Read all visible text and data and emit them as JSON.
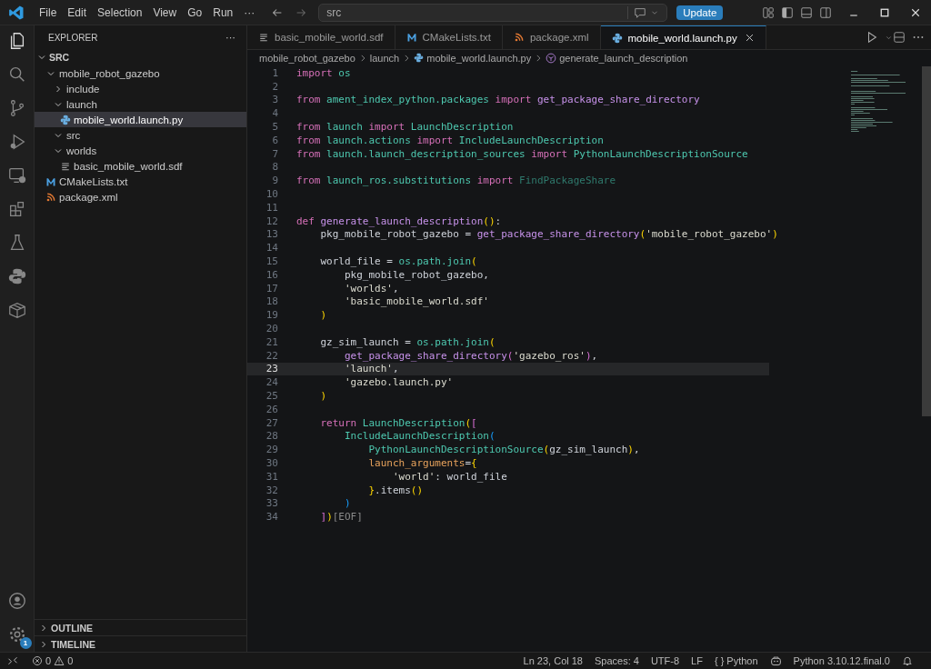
{
  "menu": [
    "File",
    "Edit",
    "Selection",
    "View",
    "Go",
    "Run",
    "···"
  ],
  "command_center": {
    "value": "src"
  },
  "update_button": "Update",
  "sidebar": {
    "title": "EXPLORER",
    "more": "···",
    "section": {
      "label": "SRC",
      "expanded": true,
      "children": [
        {
          "label": "mobile_robot_gazebo",
          "kind": "folder",
          "expanded": true,
          "selected": false,
          "children": [
            {
              "label": "include",
              "kind": "folder",
              "expanded": false,
              "selected": false
            },
            {
              "label": "launch",
              "kind": "folder",
              "expanded": true,
              "selected": false,
              "children": [
                {
                  "label": "mobile_world.launch.py",
                  "kind": "py",
                  "selected": true
                }
              ]
            },
            {
              "label": "src",
              "kind": "folder",
              "expanded": true,
              "selected": false
            },
            {
              "label": "worlds",
              "kind": "folder",
              "expanded": true,
              "selected": false,
              "children": [
                {
                  "label": "basic_mobile_world.sdf",
                  "kind": "sdf",
                  "selected": false
                }
              ]
            }
          ]
        },
        {
          "label": "CMakeLists.txt",
          "kind": "cmake",
          "selected": false
        },
        {
          "label": "package.xml",
          "kind": "xml",
          "selected": false
        }
      ]
    },
    "panels": [
      {
        "label": "OUTLINE",
        "expanded": false
      },
      {
        "label": "TIMELINE",
        "expanded": false
      }
    ]
  },
  "settings_badge": "1",
  "tabs": [
    {
      "label": "basic_mobile_world.sdf",
      "kind": "sdf",
      "selected": false
    },
    {
      "label": "CMakeLists.txt",
      "kind": "cmake",
      "selected": false
    },
    {
      "label": "package.xml",
      "kind": "xml",
      "selected": false
    },
    {
      "label": "mobile_world.launch.py",
      "kind": "py",
      "selected": true
    }
  ],
  "breadcrumbs": [
    {
      "label": "mobile_robot_gazebo",
      "kind": "folder"
    },
    {
      "label": "launch",
      "kind": "folder"
    },
    {
      "label": "mobile_world.launch.py",
      "kind": "py"
    },
    {
      "label": "generate_launch_description",
      "kind": "symbol"
    }
  ],
  "code": [
    {
      "n": "1",
      "current": false,
      "tokens": [
        {
          "t": "import",
          "kind": "kw"
        },
        {
          "t": " os",
          "kind": "mod"
        }
      ]
    },
    {
      "n": "2",
      "current": false
    },
    {
      "n": "3",
      "current": false,
      "tokens": [
        {
          "t": "from",
          "kind": "kw"
        },
        {
          "t": " ament_index_python.packages",
          "kind": "mod"
        },
        {
          "t": " import",
          "kind": "kw"
        },
        {
          "t": " get_package_share_directory",
          "kind": "fn"
        }
      ]
    },
    {
      "n": "4",
      "current": false
    },
    {
      "n": "5",
      "current": false,
      "tokens": [
        {
          "t": "from",
          "kind": "kw"
        },
        {
          "t": " launch",
          "kind": "mod"
        },
        {
          "t": " import",
          "kind": "kw"
        },
        {
          "t": " LaunchDescription",
          "kind": "mod"
        }
      ]
    },
    {
      "n": "6",
      "current": false,
      "tokens": [
        {
          "t": "from",
          "kind": "kw"
        },
        {
          "t": " launch.actions",
          "kind": "mod"
        },
        {
          "t": " import",
          "kind": "kw"
        },
        {
          "t": " IncludeLaunchDescription",
          "kind": "mod"
        }
      ]
    },
    {
      "n": "7",
      "current": false,
      "tokens": [
        {
          "t": "from",
          "kind": "kw"
        },
        {
          "t": " launch.launch_description_sources",
          "kind": "mod"
        },
        {
          "t": " import",
          "kind": "kw"
        },
        {
          "t": " PythonLaunchDescriptionSource",
          "kind": "mod"
        }
      ]
    },
    {
      "n": "8",
      "current": false
    },
    {
      "n": "9",
      "current": false,
      "tokens": [
        {
          "t": "from",
          "kind": "kw"
        },
        {
          "t": " launch_ros.substitutions",
          "kind": "mod"
        },
        {
          "t": " import",
          "kind": "kw"
        },
        {
          "t": " FindPackageShare",
          "kind": "unused"
        }
      ]
    },
    {
      "n": "10",
      "current": false
    },
    {
      "n": "11",
      "current": false
    },
    {
      "n": "12",
      "current": false,
      "tokens": [
        {
          "t": "def",
          "kind": "kw"
        },
        {
          "t": " generate_launch_description",
          "kind": "fn"
        },
        {
          "t": "()",
          "kind": "by"
        },
        {
          "t": ":",
          "kind": "plain"
        }
      ]
    },
    {
      "n": "13",
      "current": false,
      "tokens": [
        {
          "t": "    pkg_mobile_robot_gazebo =",
          "kind": "plain"
        },
        {
          "t": " get_package_share_directory",
          "kind": "fn"
        },
        {
          "t": "(",
          "kind": "by"
        },
        {
          "t": "'mobile_robot_gazebo'",
          "kind": "str"
        },
        {
          "t": ")",
          "kind": "by"
        }
      ]
    },
    {
      "n": "14",
      "current": false
    },
    {
      "n": "15",
      "current": false,
      "tokens": [
        {
          "t": "    world_file =",
          "kind": "plain"
        },
        {
          "t": " os.path.join",
          "kind": "mod"
        },
        {
          "t": "(",
          "kind": "by"
        }
      ]
    },
    {
      "n": "16",
      "current": false,
      "tokens": [
        {
          "t": "        pkg_mobile_robot_gazebo,",
          "kind": "plain"
        }
      ]
    },
    {
      "n": "17",
      "current": false,
      "tokens": [
        {
          "t": "        'worlds'",
          "kind": "str"
        },
        {
          "t": ",",
          "kind": "plain"
        }
      ]
    },
    {
      "n": "18",
      "current": false,
      "tokens": [
        {
          "t": "        'basic_mobile_world.sdf'",
          "kind": "str"
        }
      ]
    },
    {
      "n": "19",
      "current": false,
      "tokens": [
        {
          "t": "    )",
          "kind": "by"
        }
      ]
    },
    {
      "n": "20",
      "current": false
    },
    {
      "n": "21",
      "current": false,
      "tokens": [
        {
          "t": "    gz_sim_launch =",
          "kind": "plain"
        },
        {
          "t": " os.path.join",
          "kind": "mod"
        },
        {
          "t": "(",
          "kind": "by"
        }
      ]
    },
    {
      "n": "22",
      "current": false,
      "tokens": [
        {
          "t": "        get_package_share_directory",
          "kind": "fn"
        },
        {
          "t": "(",
          "kind": "bp"
        },
        {
          "t": "'gazebo_ros'",
          "kind": "str"
        },
        {
          "t": ")",
          "kind": "bp"
        },
        {
          "t": ",",
          "kind": "plain"
        }
      ]
    },
    {
      "n": "23",
      "current": true,
      "tokens": [
        {
          "t": "        'launch'",
          "kind": "str"
        },
        {
          "t": ",",
          "kind": "plain"
        }
      ]
    },
    {
      "n": "24",
      "current": false,
      "tokens": [
        {
          "t": "        'gazebo.launch.py'",
          "kind": "str"
        }
      ]
    },
    {
      "n": "25",
      "current": false,
      "tokens": [
        {
          "t": "    )",
          "kind": "by"
        }
      ]
    },
    {
      "n": "26",
      "current": false
    },
    {
      "n": "27",
      "current": false,
      "tokens": [
        {
          "t": "    return",
          "kind": "kw"
        },
        {
          "t": " LaunchDescription",
          "kind": "mod"
        },
        {
          "t": "(",
          "kind": "by"
        },
        {
          "t": "[",
          "kind": "bp"
        }
      ]
    },
    {
      "n": "28",
      "current": false,
      "tokens": [
        {
          "t": "        IncludeLaunchDescription",
          "kind": "mod"
        },
        {
          "t": "(",
          "kind": "bb"
        }
      ]
    },
    {
      "n": "29",
      "current": false,
      "tokens": [
        {
          "t": "            PythonLaunchDescriptionSource",
          "kind": "mod"
        },
        {
          "t": "(",
          "kind": "by"
        },
        {
          "t": "gz_sim_launch",
          "kind": "plain"
        },
        {
          "t": ")",
          "kind": "by"
        },
        {
          "t": ",",
          "kind": "plain"
        }
      ]
    },
    {
      "n": "30",
      "current": false,
      "tokens": [
        {
          "t": "            launch_arguments",
          "kind": "param"
        },
        {
          "t": "=",
          "kind": "plain"
        },
        {
          "t": "{",
          "kind": "by"
        }
      ]
    },
    {
      "n": "31",
      "current": false,
      "tokens": [
        {
          "t": "                'world'",
          "kind": "str"
        },
        {
          "t": ": world_file",
          "kind": "plain"
        }
      ]
    },
    {
      "n": "32",
      "current": false,
      "tokens": [
        {
          "t": "            }",
          "kind": "by"
        },
        {
          "t": ".items",
          "kind": "plain"
        },
        {
          "t": "()",
          "kind": "by"
        }
      ]
    },
    {
      "n": "33",
      "current": false,
      "tokens": [
        {
          "t": "        )",
          "kind": "bb"
        }
      ]
    },
    {
      "n": "34",
      "current": false,
      "tokens": [
        {
          "t": "    ]",
          "kind": "bp"
        },
        {
          "t": ")",
          "kind": "by"
        },
        {
          "t": "[EOF]",
          "kind": "eof"
        }
      ]
    }
  ],
  "status_bar": {
    "errors": "0",
    "warnings": "0",
    "cursor": "Ln 23, Col 18",
    "indent": "Spaces: 4",
    "encoding": "UTF-8",
    "eol": "LF",
    "language_icon": "{ }",
    "language": "Python",
    "interpreter": "Python 3.10.12.final.0"
  }
}
